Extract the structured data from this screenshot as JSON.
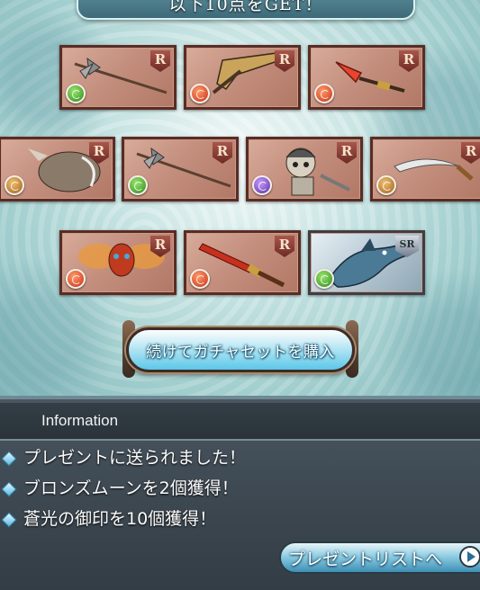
{
  "header": {
    "title": "以下10点をGET！"
  },
  "items": [
    {
      "name": "halberd",
      "rank": "R",
      "element": "wind"
    },
    {
      "name": "crossbow",
      "rank": "R",
      "element": "fire"
    },
    {
      "name": "crystal-spear",
      "rank": "R",
      "element": "fire"
    },
    {
      "name": "beast",
      "rank": "R",
      "element": "earth"
    },
    {
      "name": "halberd-2",
      "rank": "R",
      "element": "wind"
    },
    {
      "name": "skeleton",
      "rank": "R",
      "element": "dark"
    },
    {
      "name": "scimitar",
      "rank": "R",
      "element": "earth"
    },
    {
      "name": "moth-creature",
      "rank": "R",
      "element": "fire"
    },
    {
      "name": "red-sword",
      "rank": "R",
      "element": "fire"
    },
    {
      "name": "dragon",
      "rank": "SR",
      "element": "wind"
    }
  ],
  "actions": {
    "gacha_button": "続けてガチャセットを購入"
  },
  "info": {
    "title": "Information",
    "messages": [
      "プレゼントに送られました！",
      "ブロンズムーンを2個獲得！",
      "蒼光の御印を10個獲得！"
    ],
    "present_button": "プレゼントリストへ"
  }
}
